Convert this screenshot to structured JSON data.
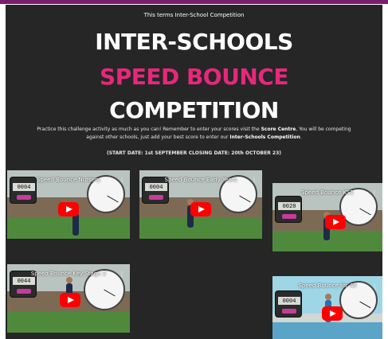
{
  "header": {
    "kicker": "This terms Inter-School Competition",
    "title_line1": "INTER-SCHOOLS",
    "title_line2": "SPEED BOUNCE",
    "title_line3": "COMPETITION",
    "intro_part1": "Practice this challenge activity as much as you can! Remember to enter your scores visit the ",
    "intro_link": "Score Centre",
    "intro_part2": ", You will be competing against other schools,  just add your best score to enter our ",
    "intro_bold": "Inter-Schools Competition",
    "intro_end": ".",
    "dates": "(START DATE: 1st SEPTEMBER CLOSING DATE:  20th OCTOBER  23)"
  },
  "colors": {
    "accent_pink": "#e6287a",
    "panel_bg": "#262626",
    "play_red": "#ff0000"
  },
  "videos": [
    {
      "title": "Speed Bounce Nursery",
      "counter": "0004",
      "more": "⋮"
    },
    {
      "title": "Speed Bounce Early Years",
      "counter": "0004",
      "more": "⋮"
    },
    {
      "title": "Speed Bounce KS1",
      "counter": "0020",
      "more": "⋮"
    },
    {
      "title": "Speed Bounce Key Stage 2",
      "counter": "0044",
      "more": "⋮"
    },
    {
      "title": "Speed Bounce for All",
      "counter": "0004",
      "more": "⋮"
    }
  ]
}
